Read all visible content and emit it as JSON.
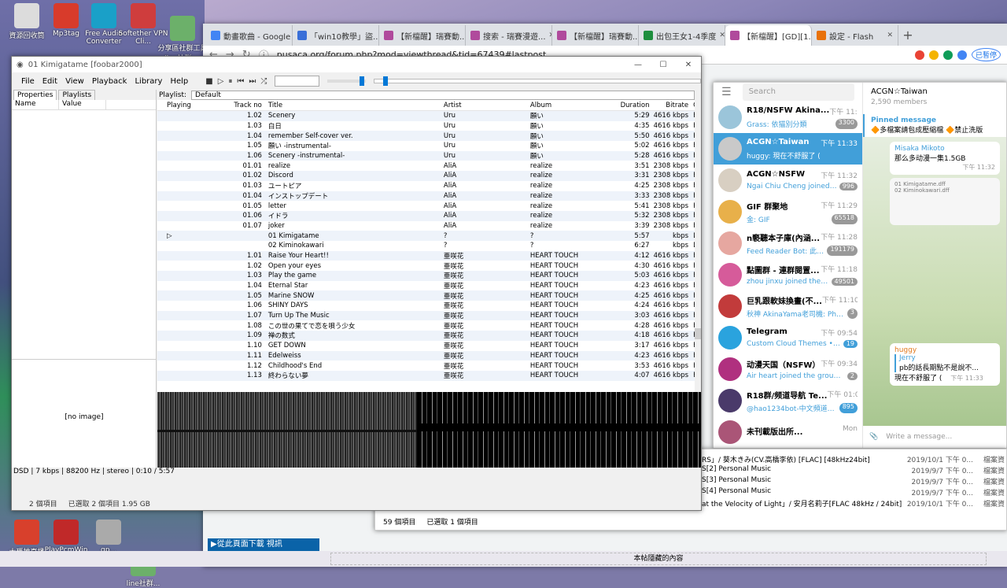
{
  "desktop": {
    "icons": [
      {
        "label": "資源回收筒",
        "color": "#dcdcdc"
      },
      {
        "label": "Mp3tag",
        "color": "#d83b2b"
      },
      {
        "label": "Free Audio Converter",
        "color": "#1aa0c8"
      },
      {
        "label": "Softether VPN Cli...",
        "color": "#cf3d3d"
      },
      {
        "label": "分享區社群工具 line社群 ...",
        "color": "#6cb06a"
      },
      {
        "label": "大瑪雄直播",
        "color": "#d8402c"
      },
      {
        "label": "PlayPcmWin (64 bit)",
        "color": "#c02929"
      },
      {
        "label": "qp...",
        "color": "#aaa"
      },
      {
        "label": "line社群...",
        "color": "#6cb06a"
      }
    ]
  },
  "chrome": {
    "tabs": [
      {
        "label": "動畫歌曲 - Google",
        "fav": "#4285f4"
      },
      {
        "label": "「win10教學」盜...",
        "fav": "#3a6fd8"
      },
      {
        "label": "【新檔醒】瑞賽動...",
        "fav": "#b04a9c"
      },
      {
        "label": "搜索 - 瑞賽漫遊...",
        "fav": "#b04a9c"
      },
      {
        "label": "【新檔醒】瑞賽動...",
        "fav": "#b04a9c"
      },
      {
        "label": "出包王女1-4季度",
        "fav": "#1e8e3e"
      },
      {
        "label": "【新檔醒】[GD][1...",
        "fav": "#b04a9c",
        "active": true
      },
      {
        "label": "設定 - Flash",
        "fav": "#e8710a"
      }
    ],
    "url": "pusaca.org/forum.php?mod=viewthread&tid=67439#lastpost",
    "paused": "已暫停"
  },
  "telegram": {
    "search": "Search",
    "chats": [
      {
        "name": "R18/NSFW Akina...",
        "time": "下午 11:26",
        "preview": "Grass: 依猫別分類",
        "badge": "3300",
        "color": "#9bc5da"
      },
      {
        "name": "ACGN☆Taiwan",
        "time": "下午 11:33",
        "preview": "huggy: 現在不舒服了 (",
        "badge": "",
        "color": "#c9c9c9",
        "selected": true
      },
      {
        "name": "ACGN☆NSFW",
        "time": "下午 11:32",
        "preview": "Ngai Chiu Cheng joined the...",
        "badge": "996",
        "color": "#d8cfc2"
      },
      {
        "name": "GIF 群聚地",
        "time": "下午 11:29",
        "preview": "金: GIF",
        "badge": "65518",
        "color": "#e8b04a"
      },
      {
        "name": "n褻聽本子庫(內涵...",
        "time": "下午 11:28",
        "preview": "Feed Reader Bot: 此說...",
        "badge": "191179",
        "color": "#e6a7a0"
      },
      {
        "name": "點圖群 - 連群閱置...",
        "time": "下午 11:18",
        "preview": "zhou jinxu joined the gro...",
        "badge": "49501",
        "color": "#d65b9a"
      },
      {
        "name": "巨乳跟軟妹換畫(不...",
        "time": "下午 11:10",
        "preview": "秋神 AkinaYama老司機: Photo",
        "badge": "3",
        "color": "#c23b3b"
      },
      {
        "name": "Telegram",
        "time": "下午 09:54",
        "preview": "Custom Cloud Themes • Cre...",
        "badge": "19",
        "color": "#2aa3de"
      },
      {
        "name": "动漫天国（NSFW）",
        "time": "下午 09:34",
        "preview": "Air heart joined the group via...",
        "badge": "2",
        "color": "#b0307f"
      },
      {
        "name": "R18群/频道导航 Te...",
        "time": "下午 01:08",
        "preview": "@hao1234bot-中文頻道群...",
        "badge": "895",
        "color": "#4a3a6a"
      },
      {
        "name": "未刊載版出所...",
        "time": "Mon",
        "preview": "",
        "badge": "",
        "color": "#aa5577"
      }
    ],
    "header": {
      "name": "ACGN☆Taiwan",
      "members": "2,590 members"
    },
    "pinned": {
      "title": "Pinned message",
      "text": "🔶多檔案請包成壓縮檔 🔶禁止洗版"
    },
    "msg1": {
      "sender": "Misaka Mikoto",
      "text": "那么多动漫一集1.5GB",
      "time": "下午 11:32"
    },
    "msg2": {
      "sender": "huggy",
      "reply_name": "Jerry",
      "reply_text": "pb的話長期點不是說不...",
      "text": "現在不舒服了 (",
      "time": "下午 11:33"
    },
    "input": "Write a message..."
  },
  "explorer": {
    "rows": [
      {
        "name": "RS」/ 葵木きみ(CV.高橋李依) [FLAC] [48kHz24bit]",
        "date": "2019/10/1 下午 0...",
        "kind": "檔案資"
      },
      {
        "name": "S[2] Personal Music",
        "date": "2019/9/7 下午 0...",
        "kind": "檔案資"
      },
      {
        "name": "S[3] Personal Music",
        "date": "2019/9/7 下午 0...",
        "kind": "檔案資"
      },
      {
        "name": "S[4] Personal Music",
        "date": "2019/9/7 下午 0...",
        "kind": "檔案資"
      },
      {
        "name": "at the Velocity of Light」/ 安月名莉子[FLAC 48kHz / 24bit]",
        "date": "2019/10/1 下午 0...",
        "kind": "檔案資"
      }
    ],
    "count": "59 個項目",
    "selected": "已選取 1 個項目"
  },
  "foobar": {
    "title": "01 Kimigatame [foobar2000]",
    "menu": [
      "File",
      "Edit",
      "View",
      "Playback",
      "Library",
      "Help"
    ],
    "left_tabs": [
      "Properties",
      "Playlists"
    ],
    "left_cols": [
      "Name",
      "Value"
    ],
    "no_image": "[no image]",
    "playlist_label": "Playlist:",
    "playlist_name": "Default",
    "columns": [
      "Playing",
      "Track no",
      "Title",
      "Artist",
      "Album",
      "Duration",
      "Bitrate",
      "C"
    ],
    "tracks": [
      [
        "",
        "1.02",
        "Scenery",
        "Uru",
        "願い",
        "5:29",
        "4616 kbps",
        "FL"
      ],
      [
        "",
        "1.03",
        "白日",
        "Uru",
        "願い",
        "4:35",
        "4616 kbps",
        "FL"
      ],
      [
        "",
        "1.04",
        "remember Self-cover ver.",
        "Uru",
        "願い",
        "5:50",
        "4616 kbps",
        "FL"
      ],
      [
        "",
        "1.05",
        "願い -instrumental-",
        "Uru",
        "願い",
        "5:02",
        "4616 kbps",
        "FL"
      ],
      [
        "",
        "1.06",
        "Scenery -instrumental-",
        "Uru",
        "願い",
        "5:28",
        "4616 kbps",
        "FL"
      ],
      [
        "",
        "01.01",
        "realize",
        "AliA",
        "realize",
        "3:51",
        "2308 kbps",
        "FL"
      ],
      [
        "",
        "01.02",
        "Discord",
        "AliA",
        "realize",
        "3:31",
        "2308 kbps",
        "FL"
      ],
      [
        "",
        "01.03",
        "ユートピア",
        "AliA",
        "realize",
        "4:25",
        "2308 kbps",
        "FL"
      ],
      [
        "",
        "01.04",
        "インストップデート",
        "AliA",
        "realize",
        "3:33",
        "2308 kbps",
        "FL"
      ],
      [
        "",
        "01.05",
        "letter",
        "AliA",
        "realize",
        "5:41",
        "2308 kbps",
        "FL"
      ],
      [
        "",
        "01.06",
        "イドラ",
        "AliA",
        "realize",
        "5:32",
        "2308 kbps",
        "FL"
      ],
      [
        "",
        "01.07",
        "joker",
        "AliA",
        "realize",
        "3:39",
        "2308 kbps",
        "FL"
      ],
      [
        "▷",
        "",
        "01 Kimigatame",
        "?",
        "?",
        "5:57",
        "kbps",
        "D"
      ],
      [
        "",
        "",
        "02 Kiminokawari",
        "?",
        "?",
        "6:27",
        "kbps",
        "D"
      ],
      [
        "",
        "1.01",
        "Raise Your Heart!!",
        "亜咲花",
        "HEART TOUCH",
        "4:12",
        "4616 kbps",
        "FL"
      ],
      [
        "",
        "1.02",
        "Open your eyes",
        "亜咲花",
        "HEART TOUCH",
        "4:30",
        "4616 kbps",
        "FL"
      ],
      [
        "",
        "1.03",
        "Play the game",
        "亜咲花",
        "HEART TOUCH",
        "5:03",
        "4616 kbps",
        "FL"
      ],
      [
        "",
        "1.04",
        "Eternal Star",
        "亜咲花",
        "HEART TOUCH",
        "4:23",
        "4616 kbps",
        "FL"
      ],
      [
        "",
        "1.05",
        "Marine SNOW",
        "亜咲花",
        "HEART TOUCH",
        "4:25",
        "4616 kbps",
        "FL"
      ],
      [
        "",
        "1.06",
        "SHINY DAYS",
        "亜咲花",
        "HEART TOUCH",
        "4:24",
        "4616 kbps",
        "FL"
      ],
      [
        "",
        "1.07",
        "Turn Up The Music",
        "亜咲花",
        "HEART TOUCH",
        "3:03",
        "4616 kbps",
        "FL"
      ],
      [
        "",
        "1.08",
        "この世の果てで恋を唄う少女",
        "亜咲花",
        "HEART TOUCH",
        "4:28",
        "4616 kbps",
        "FL"
      ],
      [
        "",
        "1.09",
        "禅の数式",
        "亜咲花",
        "HEART TOUCH",
        "4:18",
        "4616 kbps",
        "FL"
      ],
      [
        "",
        "1.10",
        "GET DOWN",
        "亜咲花",
        "HEART TOUCH",
        "3:17",
        "4616 kbps",
        "FL"
      ],
      [
        "",
        "1.11",
        "Edelweiss",
        "亜咲花",
        "HEART TOUCH",
        "4:23",
        "4616 kbps",
        "FL"
      ],
      [
        "",
        "1.12",
        "Childhood's End",
        "亜咲花",
        "HEART TOUCH",
        "3:53",
        "4616 kbps",
        "FL"
      ],
      [
        "",
        "1.13",
        "終わらない夢",
        "亜咲花",
        "HEART TOUCH",
        "4:07",
        "4616 kbps",
        "FL"
      ]
    ],
    "status": "DSD | 7 kbps | 88200 Hz | stereo | 0:10 / 5:57",
    "items": "2 個項目",
    "selected": "已選取 2 個項目 1.95 GB",
    "seek_fraction": 0.028,
    "volume_fraction": 0.85
  },
  "download_bar": "▶從此頁面下載 視訊",
  "hidden_hint": "本帖隱藏的內容"
}
